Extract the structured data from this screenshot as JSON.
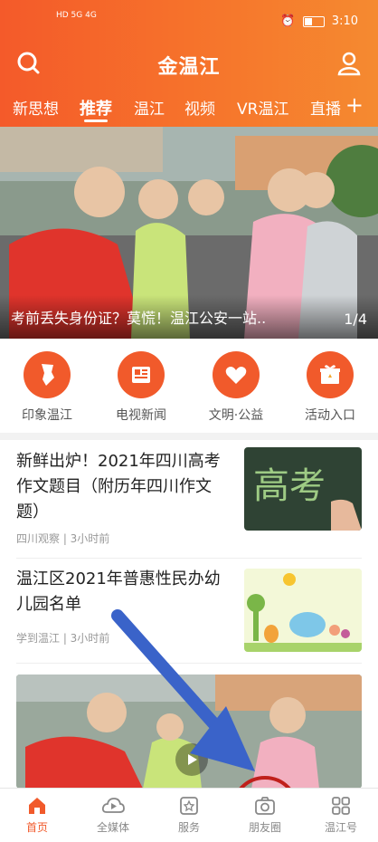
{
  "status": {
    "left": "HD 5G 4G",
    "time": "3:10"
  },
  "app": {
    "title": "金温江"
  },
  "tabs": [
    {
      "label": "新思想"
    },
    {
      "label": "推荐"
    },
    {
      "label": "温江"
    },
    {
      "label": "视频"
    },
    {
      "label": "VR温江"
    },
    {
      "label": "直播"
    }
  ],
  "hero": {
    "caption": "考前丢失身份证？莫慌！温江公安一站..",
    "page": "1/4"
  },
  "quick_links": [
    {
      "label": "印象温江",
      "icon": "map-icon"
    },
    {
      "label": "电视新闻",
      "icon": "newspaper-icon"
    },
    {
      "label": "文明·公益",
      "icon": "heart-icon"
    },
    {
      "label": "活动入口",
      "icon": "gift-icon"
    }
  ],
  "news": [
    {
      "title": "新鲜出炉！2021年四川高考作文题目（附历年四川作文题）",
      "meta": "四川观察 | 3小时前",
      "thumb_text": "高考"
    },
    {
      "title": "温江区2021年普惠性民办幼儿园名单",
      "meta": "学到温江 | 3小时前"
    }
  ],
  "bottom_nav": [
    {
      "label": "首页",
      "icon": "home-icon",
      "active": true
    },
    {
      "label": "全媒体",
      "icon": "cloud-play-icon"
    },
    {
      "label": "服务",
      "icon": "star-shield-icon"
    },
    {
      "label": "朋友圈",
      "icon": "camera-icon"
    },
    {
      "label": "温江号",
      "icon": "grid-icon"
    }
  ],
  "colors": {
    "accent": "#f15a2b",
    "annotation_arrow": "#3a63c9",
    "annotation_circle": "#c0201b"
  }
}
